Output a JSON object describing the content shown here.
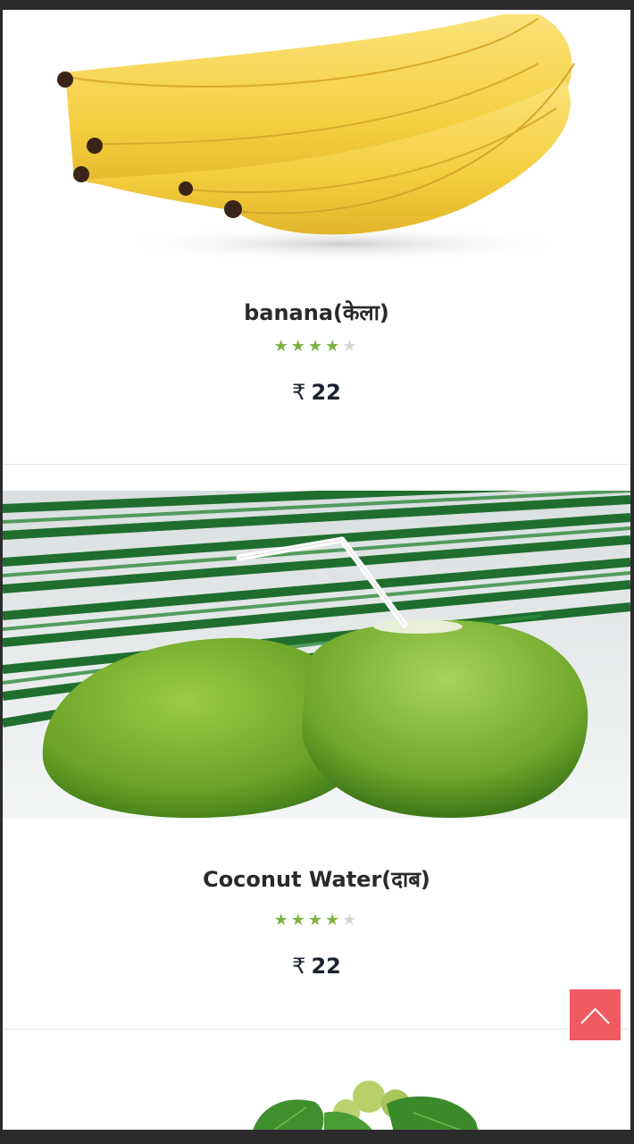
{
  "colors": {
    "star_filled": "#7cb342",
    "star_empty": "#d6d6d6",
    "back_to_top_bg": "#ef5b61",
    "price_text": "#1b2230"
  },
  "products": [
    {
      "name": "banana(केला)",
      "rating": 4,
      "rating_max": 5,
      "currency": "₹",
      "price": "22",
      "image": "banana-image"
    },
    {
      "name": "Coconut Water(दाब)",
      "rating": 4,
      "rating_max": 5,
      "currency": "₹",
      "price": "22",
      "image": "coconut-image"
    },
    {
      "image": "grapes-image"
    }
  ],
  "back_to_top": {
    "icon": "chevron-up-icon"
  }
}
